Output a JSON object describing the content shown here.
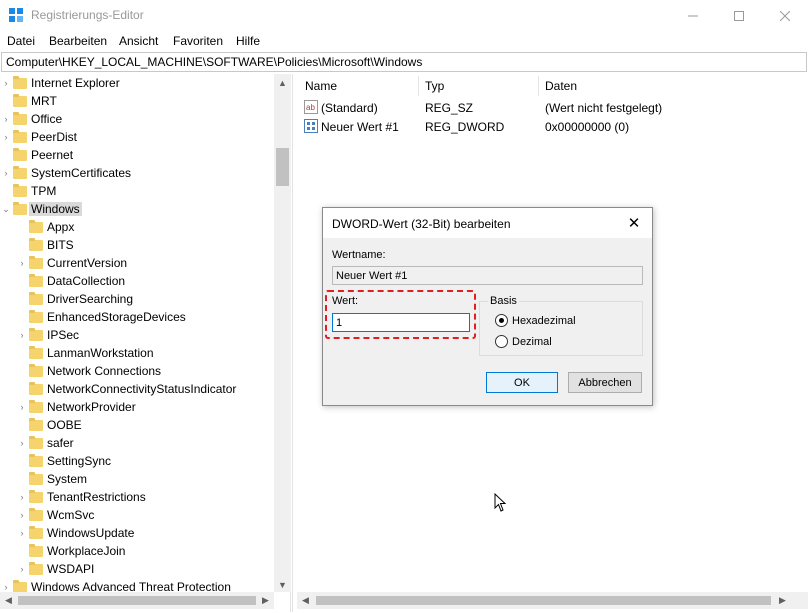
{
  "window": {
    "title": "Registrierungs-Editor",
    "controls": {
      "minimize": "—",
      "maximize": "☐",
      "close": "✕"
    }
  },
  "menu": [
    "Datei",
    "Bearbeiten",
    "Ansicht",
    "Favoriten",
    "Hilfe"
  ],
  "address": "Computer\\HKEY_LOCAL_MACHINE\\SOFTWARE\\Policies\\Microsoft\\Windows",
  "tree": {
    "items": [
      {
        "label": "Internet Explorer",
        "level": 0,
        "expandable": true
      },
      {
        "label": "MRT",
        "level": 0,
        "expandable": false
      },
      {
        "label": "Office",
        "level": 0,
        "expandable": true
      },
      {
        "label": "PeerDist",
        "level": 0,
        "expandable": true
      },
      {
        "label": "Peernet",
        "level": 0,
        "expandable": false
      },
      {
        "label": "SystemCertificates",
        "level": 0,
        "expandable": true
      },
      {
        "label": "TPM",
        "level": 0,
        "expandable": false
      },
      {
        "label": "Windows",
        "level": 0,
        "expandable": true,
        "expanded": true,
        "selected": true
      },
      {
        "label": "Appx",
        "level": 1,
        "expandable": false
      },
      {
        "label": "BITS",
        "level": 1,
        "expandable": false
      },
      {
        "label": "CurrentVersion",
        "level": 1,
        "expandable": true
      },
      {
        "label": "DataCollection",
        "level": 1,
        "expandable": false
      },
      {
        "label": "DriverSearching",
        "level": 1,
        "expandable": false
      },
      {
        "label": "EnhancedStorageDevices",
        "level": 1,
        "expandable": false
      },
      {
        "label": "IPSec",
        "level": 1,
        "expandable": true
      },
      {
        "label": "LanmanWorkstation",
        "level": 1,
        "expandable": false
      },
      {
        "label": "Network Connections",
        "level": 1,
        "expandable": false
      },
      {
        "label": "NetworkConnectivityStatusIndicator",
        "level": 1,
        "expandable": false
      },
      {
        "label": "NetworkProvider",
        "level": 1,
        "expandable": true
      },
      {
        "label": "OOBE",
        "level": 1,
        "expandable": false
      },
      {
        "label": "safer",
        "level": 1,
        "expandable": true
      },
      {
        "label": "SettingSync",
        "level": 1,
        "expandable": false
      },
      {
        "label": "System",
        "level": 1,
        "expandable": false
      },
      {
        "label": "TenantRestrictions",
        "level": 1,
        "expandable": true
      },
      {
        "label": "WcmSvc",
        "level": 1,
        "expandable": true
      },
      {
        "label": "WindowsUpdate",
        "level": 1,
        "expandable": true
      },
      {
        "label": "WorkplaceJoin",
        "level": 1,
        "expandable": false
      },
      {
        "label": "WSDAPI",
        "level": 1,
        "expandable": true
      },
      {
        "label": "Windows Advanced Threat Protection",
        "level": 0,
        "expandable": true
      }
    ],
    "icons": {
      "expand": "chevron-right-icon",
      "collapse": "chevron-down-icon",
      "folder": "folder-icon"
    }
  },
  "values": {
    "columns": [
      "Name",
      "Typ",
      "Daten"
    ],
    "rows": [
      {
        "name": "(Standard)",
        "type": "REG_SZ",
        "data": "(Wert nicht festgelegt)",
        "icon": "string-value-icon"
      },
      {
        "name": "Neuer Wert #1",
        "type": "REG_DWORD",
        "data": "0x00000000 (0)",
        "icon": "binary-value-icon"
      }
    ]
  },
  "dialog": {
    "title": "DWORD-Wert (32-Bit) bearbeiten",
    "close": "✕",
    "name_label": "Wertname:",
    "name_value": "Neuer Wert #1",
    "value_label": "Wert:",
    "value_value": "1",
    "base_label": "Basis",
    "base_options": [
      "Hexadezimal",
      "Dezimal"
    ],
    "base_selected": "Hexadezimal",
    "ok": "OK",
    "cancel": "Abbrechen"
  },
  "colors": {
    "highlight": "#e02020",
    "selection": "#d9d9d9",
    "accent": "#0078d7",
    "folder": "#f5d46e"
  }
}
